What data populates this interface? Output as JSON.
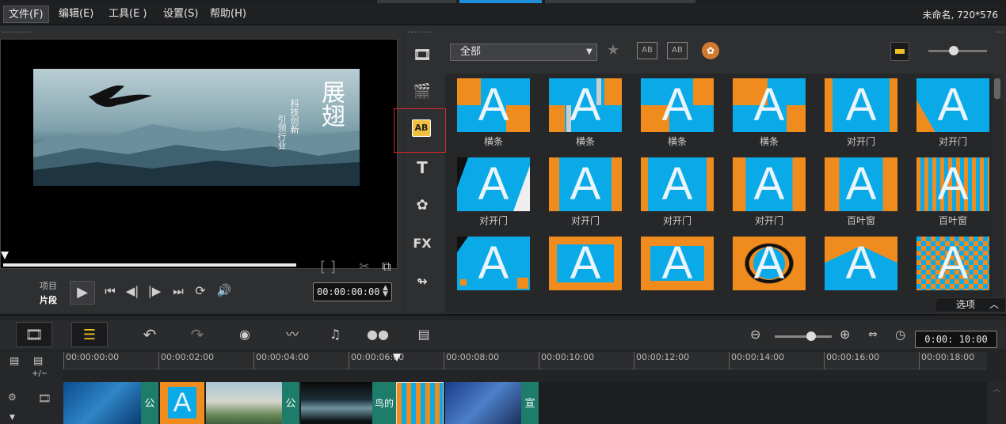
{
  "menu": {
    "items": [
      {
        "label": "文件(F)"
      },
      {
        "label": "编辑(E)"
      },
      {
        "label": "工具(E )"
      },
      {
        "label": "设置(S)"
      },
      {
        "label": "帮助(H)"
      }
    ],
    "project_info": "未命名, 720*576"
  },
  "player": {
    "mode_project": "项目",
    "mode_clip": "片段",
    "timecode": "00:00:00:00",
    "preview_text": {
      "title": "展翅",
      "line1": "科技创新",
      "line2": "引领行业"
    }
  },
  "library": {
    "filter_value": "全部",
    "options_label": "选项",
    "transitions": [
      {
        "label": "横条"
      },
      {
        "label": "横条"
      },
      {
        "label": "横条"
      },
      {
        "label": "横条"
      },
      {
        "label": "对开门"
      },
      {
        "label": "对开门"
      },
      {
        "label": "对开门"
      },
      {
        "label": "对开门"
      },
      {
        "label": "对开门"
      },
      {
        "label": "对开门"
      },
      {
        "label": "百叶窗"
      },
      {
        "label": "百叶窗"
      },
      {
        "label": ""
      },
      {
        "label": ""
      },
      {
        "label": ""
      },
      {
        "label": ""
      },
      {
        "label": ""
      },
      {
        "label": ""
      }
    ],
    "thumb_glyph": "A",
    "side_tools": [
      "media-icon",
      "instant-project-icon",
      "transition-icon",
      "title-icon",
      "graphic-icon",
      "filter-icon",
      "path-icon"
    ],
    "fx_label": "FX",
    "title_tool_label": "T"
  },
  "timeline": {
    "timecode": "0:00: 10:00",
    "ruler": [
      "00:00:00:00",
      "00:00:02:00",
      "00:00:04:00",
      "00:00:06:00",
      "00:00:08:00",
      "00:00:10:00",
      "00:00:12:00",
      "00:00:14:00",
      "00:00:16:00",
      "00:00:18:00"
    ],
    "track_sign": "+/−",
    "clips": [
      {
        "tag": "公"
      },
      {
        "tag": "公"
      },
      {
        "tag": "鸟的"
      },
      {
        "tag": "宣"
      }
    ]
  },
  "colors": {
    "accent": "#0aa9e7",
    "orange": "#f08c1e",
    "selection": "#e0262a",
    "tag_green": "#1d7c6a"
  }
}
